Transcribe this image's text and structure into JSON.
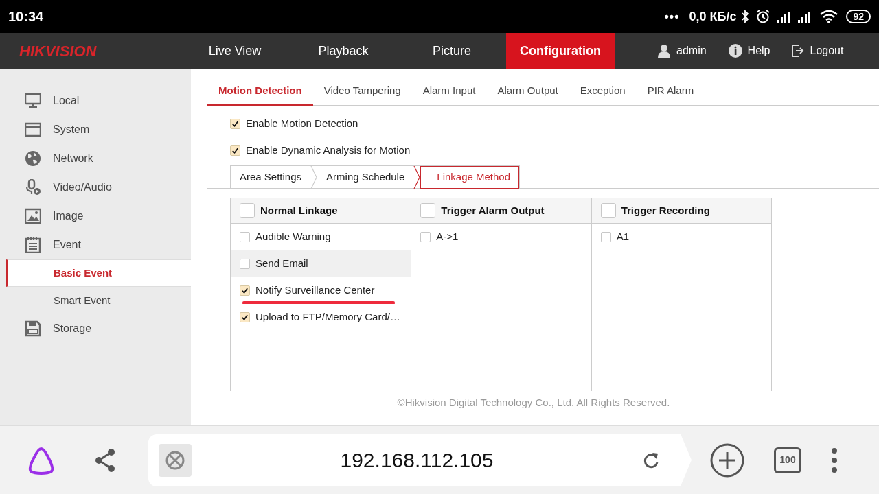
{
  "status_bar": {
    "time": "10:34",
    "dots": "•••",
    "speed": "0,0 КБ/с",
    "battery": "92"
  },
  "top_nav": {
    "logo": "HIKVISION",
    "tabs": [
      {
        "label": "Live View",
        "selected": false
      },
      {
        "label": "Playback",
        "selected": false
      },
      {
        "label": "Picture",
        "selected": false
      },
      {
        "label": "Configuration",
        "selected": true
      }
    ],
    "user": "admin",
    "help": "Help",
    "logout": "Logout"
  },
  "sidebar": {
    "items": [
      {
        "label": "Local",
        "selected": false
      },
      {
        "label": "System",
        "selected": false
      },
      {
        "label": "Network",
        "selected": false
      },
      {
        "label": "Video/Audio",
        "selected": false
      },
      {
        "label": "Image",
        "selected": false
      },
      {
        "label": "Event",
        "selected": false,
        "expanded": true,
        "children": [
          {
            "label": "Basic Event",
            "selected": true
          },
          {
            "label": "Smart Event",
            "selected": false
          }
        ]
      },
      {
        "label": "Storage",
        "selected": false
      }
    ]
  },
  "sub_tabs": [
    {
      "label": "Motion Detection",
      "selected": true
    },
    {
      "label": "Video Tampering",
      "selected": false
    },
    {
      "label": "Alarm Input",
      "selected": false
    },
    {
      "label": "Alarm Output",
      "selected": false
    },
    {
      "label": "Exception",
      "selected": false
    },
    {
      "label": "PIR Alarm",
      "selected": false
    }
  ],
  "options": [
    {
      "label": "Enable Motion Detection",
      "checked": true
    },
    {
      "label": "Enable Dynamic Analysis for Motion",
      "checked": true
    }
  ],
  "steps": [
    {
      "label": "Area Settings",
      "selected": false
    },
    {
      "label": "Arming Schedule",
      "selected": false
    },
    {
      "label": "Linkage Method",
      "selected": true
    }
  ],
  "linkage": {
    "columns": [
      {
        "title": "Normal Linkage",
        "checked": false,
        "items": [
          {
            "label": "Audible Warning",
            "checked": false,
            "hovered": false,
            "underlined": false
          },
          {
            "label": "Send Email",
            "checked": false,
            "hovered": true,
            "underlined": false
          },
          {
            "label": "Notify Surveillance Center",
            "checked": true,
            "hovered": false,
            "underlined": true
          },
          {
            "label": "Upload to FTP/Memory Card/…",
            "checked": true,
            "hovered": false,
            "underlined": false
          }
        ]
      },
      {
        "title": "Trigger Alarm Output",
        "checked": false,
        "items": [
          {
            "label": "A->1",
            "checked": false,
            "hovered": false,
            "underlined": false
          }
        ]
      },
      {
        "title": "Trigger Recording",
        "checked": false,
        "items": [
          {
            "label": "A1",
            "checked": false,
            "hovered": false,
            "underlined": false
          }
        ]
      }
    ]
  },
  "footer": "©Hikvision Digital Technology Co., Ltd. All Rights Reserved.",
  "browser_bar": {
    "url": "192.168.112.105",
    "tab_count": "100"
  }
}
